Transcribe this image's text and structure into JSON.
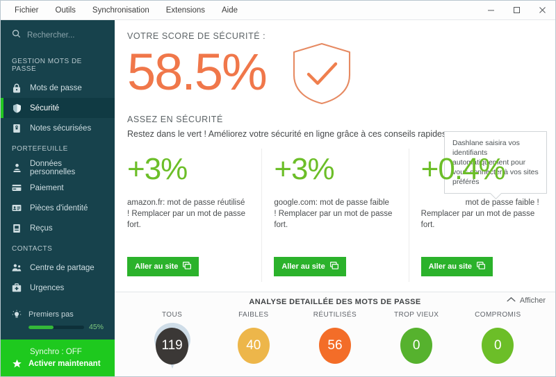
{
  "window": {
    "menu": [
      {
        "label": "Fichier",
        "name": "menu-fichier"
      },
      {
        "label": "Outils",
        "name": "menu-outils"
      },
      {
        "label": "Synchronisation",
        "name": "menu-synchronisation"
      },
      {
        "label": "Extensions",
        "name": "menu-extensions"
      },
      {
        "label": "Aide",
        "name": "menu-aide"
      }
    ],
    "controls": {
      "minimize": "minimize-button",
      "maximize": "maximize-button",
      "close": "close-button"
    }
  },
  "sidebar": {
    "search_placeholder": "Rechercher...",
    "sections": [
      {
        "label": "GESTION MOTS DE PASSE",
        "items": [
          {
            "label": "Mots de passe",
            "icon": "lock-icon",
            "active": false
          },
          {
            "label": "Sécurité",
            "icon": "shield-icon",
            "active": true
          },
          {
            "label": "Notes sécurisées",
            "icon": "note-lock-icon",
            "active": false
          }
        ]
      },
      {
        "label": "PORTEFEUILLE",
        "items": [
          {
            "label": "Données personnelles",
            "icon": "person-icon",
            "active": false
          },
          {
            "label": "Paiement",
            "icon": "credit-card-icon",
            "active": false
          },
          {
            "label": "Pièces d'identité",
            "icon": "id-card-icon",
            "active": false
          },
          {
            "label": "Reçus",
            "icon": "receipt-icon",
            "active": false
          }
        ]
      },
      {
        "label": "CONTACTS",
        "items": [
          {
            "label": "Centre de partage",
            "icon": "people-icon",
            "active": false
          },
          {
            "label": "Urgences",
            "icon": "first-aid-kit-icon",
            "active": false
          }
        ]
      }
    ],
    "first_steps": {
      "label": "Premiers pas",
      "icon": "lightbulb-icon",
      "percent_label": "45%",
      "percent_value": 45
    },
    "sync": {
      "status": "Synchro : OFF",
      "action": "Activer maintenant",
      "icon": "star-icon"
    }
  },
  "main": {
    "score_title": "VOTRE SCORE DE SÉCURITÉ :",
    "score_value": "58.5%",
    "score_color": "#f0774a",
    "shield_icon": "shield-check-icon",
    "status_title": "ASSEZ EN SÉCURITÉ",
    "status_subtitle": "Restez dans le vert ! Améliorez votre sécurité en ligne grâce à ces conseils rapides :",
    "tooltip": "Dashlane saisira vos identifiants automatiquement pour vous connecter à vos sites préférés",
    "tips": [
      {
        "percent": "+3%",
        "text": "amazon.fr: mot de passe réutilisé ! Remplacer par un mot de passe fort.",
        "button": "Aller au site",
        "button_icon": "external-window-icon"
      },
      {
        "percent": "+3%",
        "text": "google.com: mot de passe faible ! Remplacer par un mot de passe fort.",
        "button": "Aller au site",
        "button_icon": "external-window-icon"
      },
      {
        "percent": "+0.4%",
        "text": "                    mot de passe faible ! Remplacer par un mot de passe fort.",
        "button": "Aller au site",
        "button_icon": "external-window-icon"
      }
    ]
  },
  "analysis": {
    "title": "ANALYSE DETAILLÉE DES MOTS DE PASSE",
    "toggle_label": "Afficher",
    "toggle_icon": "chevron-up-icon",
    "stats": [
      {
        "label": "TOUS",
        "value": "119",
        "color": "#3b3836",
        "selected": true
      },
      {
        "label": "FAIBLES",
        "value": "40",
        "color": "#edb64a",
        "selected": false
      },
      {
        "label": "RÉUTILISÉS",
        "value": "56",
        "color": "#f36d28",
        "selected": false
      },
      {
        "label": "TROP VIEUX",
        "value": "0",
        "color": "#56b22e",
        "selected": false
      },
      {
        "label": "COMPROMIS",
        "value": "0",
        "color": "#6cbe28",
        "selected": false
      }
    ]
  },
  "colors": {
    "sidebar_bg": "#17424c",
    "accent_green": "#22c722",
    "sync_green": "#1ec91e",
    "score_orange": "#f0774a",
    "tip_green": "#6cbe28"
  }
}
